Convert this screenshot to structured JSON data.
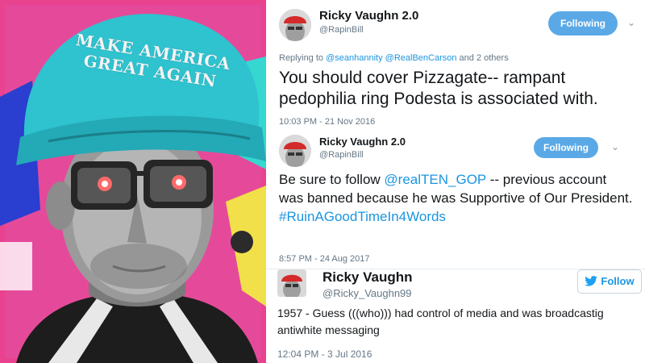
{
  "photo": {
    "cap_line1": "MAKE AMERICA",
    "cap_line2": "GREAT AGAIN",
    "colors": {
      "cap": "#2fc2cf",
      "background": "#e9428e",
      "accent": "#35d7d0"
    }
  },
  "tweets": [
    {
      "name": "Ricky Vaughn 2.0",
      "handle": "@RapinBill",
      "button_label": "Following",
      "replying_prefix": "Replying to",
      "replying_mentions": "@seanhannity @RealBenCarson",
      "replying_suffix": "and 2 others",
      "text": "You should cover Pizzagate-- rampant pedophilia ring Podesta is associated with.",
      "timestamp": "10:03 PM - 21 Nov 2016"
    },
    {
      "name": "Ricky Vaughn 2.0",
      "handle": "@RapinBill",
      "button_label": "Following",
      "text_prefix": "Be sure to follow",
      "text_mention": "@realTEN_GOP",
      "text_body": "-- previous account was banned because he was Supportive of Our President.",
      "text_hashtag": "#RuinAGoodTimeIn4Words",
      "timestamp": "8:57 PM - 24 Aug 2017"
    },
    {
      "name": "Ricky Vaughn",
      "handle": "@Ricky_Vaughn99",
      "button_label": "Follow",
      "text": "1957 - Guess (((who))) had control of media and was broadcastig antiwhite messaging",
      "timestamp": "12:04 PM - 3 Jul 2016"
    }
  ],
  "icons": {
    "chevron": "chevron-down-icon",
    "bird": "twitter-bird-icon"
  },
  "colors": {
    "link": "#1b95e0",
    "following_button": "#5aa9e6",
    "meta_text": "#657786"
  }
}
